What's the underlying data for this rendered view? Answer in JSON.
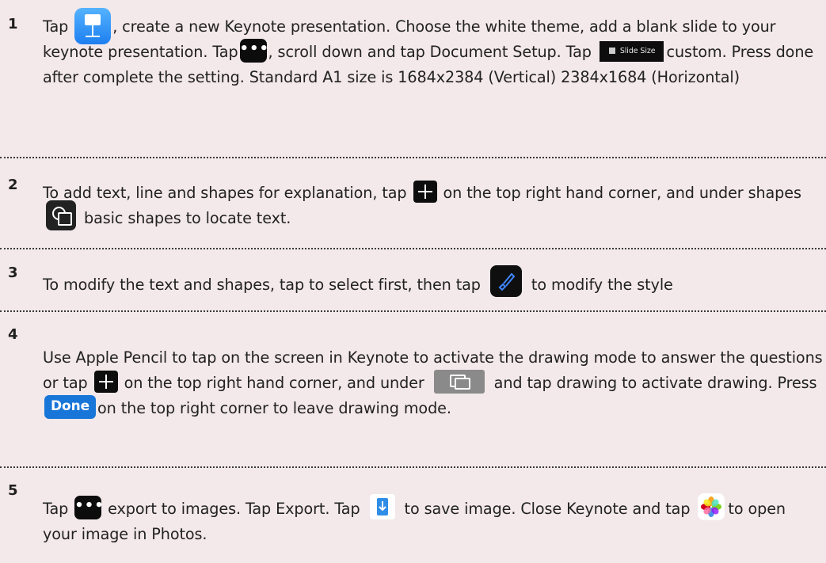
{
  "steps": [
    {
      "number": "1",
      "parts": {
        "a": "Tap ",
        "b": ", create a new Keynote presentation. Choose the white theme, add a blank slide to your keynote presentation. Tap",
        "c": ", scroll down and tap Document Setup. Tap ",
        "slide_size_label": "Slide Size",
        "d": "custom. Press done after complete the setting. Standard A1 size is 1684x2384 (Vertical) 2384x1684 (Horizontal)"
      }
    },
    {
      "number": "2",
      "parts": {
        "a": "To add text, line and shapes for explanation, tap ",
        "b": " on the top right hand corner, and under shapes ",
        "c": " basic shapes to locate text."
      }
    },
    {
      "number": "3",
      "parts": {
        "a": "To modify the text and shapes, tap to select first, then tap ",
        "b": " to modify the style"
      }
    },
    {
      "number": "4",
      "parts": {
        "a": "Use Apple Pencil to tap on the screen in Keynote to activate the drawing mode  to answer the questions or tap ",
        "b": " on the top right hand corner, and under ",
        "c": " and tap drawing to activate drawing. Press ",
        "done_label": "Done",
        "d": "on the top right corner to leave drawing mode."
      }
    },
    {
      "number": "5",
      "parts": {
        "a": "Tap ",
        "b": " export to images. Tap Export. Tap ",
        "c": " to save image. Close Keynote and tap ",
        "d": "to open your image in Photos."
      }
    }
  ],
  "icons": {
    "keynote": "keynote-app-icon",
    "more": "more-dots-icon",
    "slide_size": "slide-size-icon",
    "plus": "plus-icon",
    "shapes": "shapes-icon",
    "brush": "paintbrush-icon",
    "media": "media-icon",
    "download": "download-icon",
    "photos": "photos-app-icon"
  },
  "colors": {
    "background": "#f3e8ea",
    "accent_blue": "#1876d8"
  }
}
